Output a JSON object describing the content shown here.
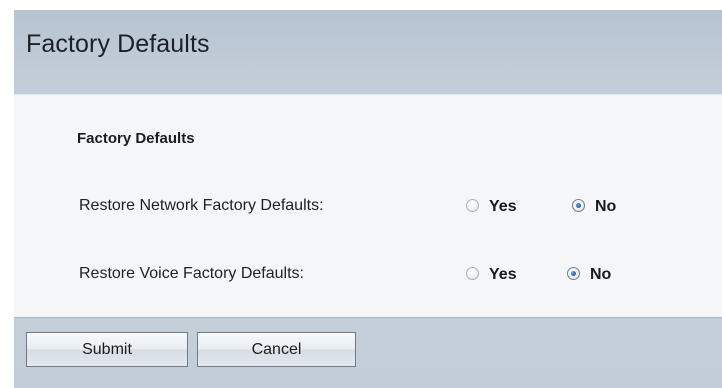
{
  "page": {
    "title": "Factory Defaults"
  },
  "panel": {
    "section_title": "Factory Defaults",
    "rows": [
      {
        "label": "Restore Network Factory Defaults:",
        "yes_label": "Yes",
        "no_label": "No",
        "selected": "No"
      },
      {
        "label": "Restore Voice Factory Defaults:",
        "yes_label": "Yes",
        "no_label": "No",
        "selected": "No"
      }
    ]
  },
  "actions": {
    "submit_label": "Submit",
    "cancel_label": "Cancel"
  },
  "colors": {
    "header_background": "#c1ccd8",
    "panel_background": "#f4f6f8",
    "radio_selected": "#2a58a8"
  }
}
